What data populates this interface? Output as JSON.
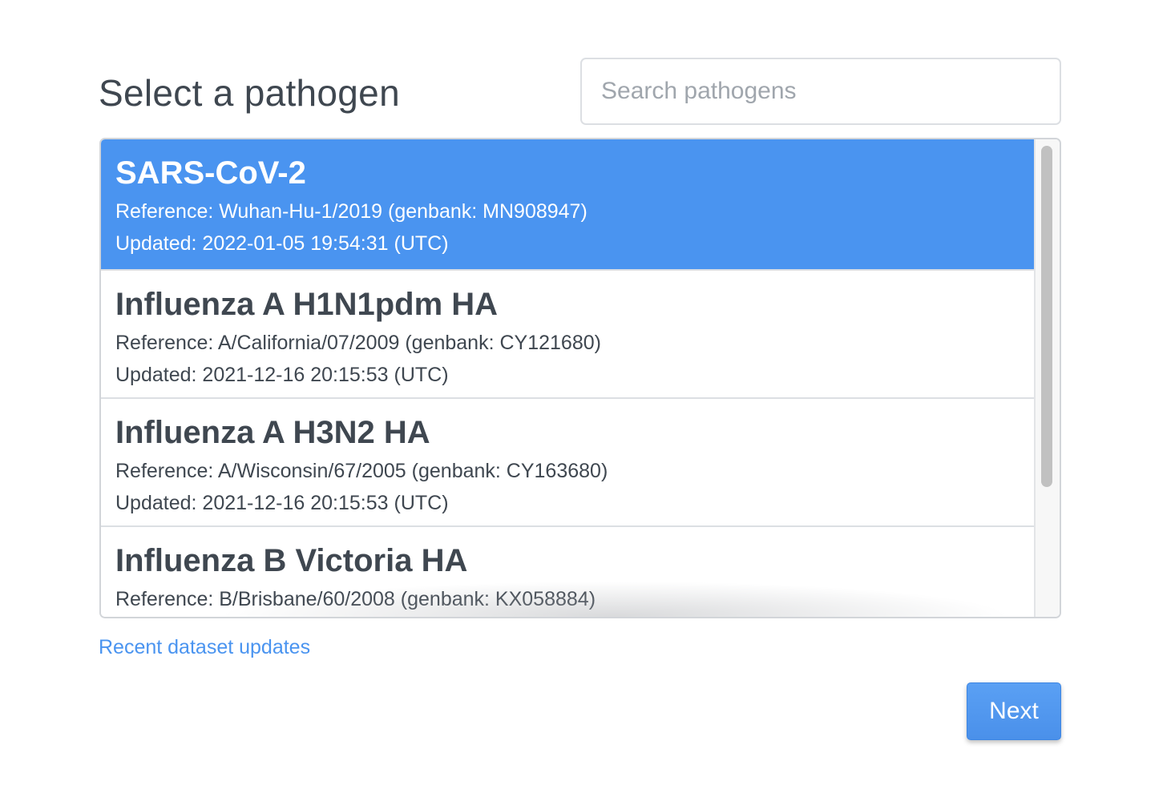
{
  "header": {
    "title": "Select a pathogen"
  },
  "search": {
    "placeholder": "Search pathogens",
    "value": ""
  },
  "pathogens": [
    {
      "name": "SARS-CoV-2",
      "reference": "Reference: Wuhan-Hu-1/2019 (genbank: MN908947)",
      "updated": "Updated: 2022-01-05 19:54:31 (UTC)",
      "selected": true
    },
    {
      "name": "Influenza A H1N1pdm HA",
      "reference": "Reference: A/California/07/2009 (genbank: CY121680)",
      "updated": "Updated: 2021-12-16 20:15:53 (UTC)",
      "selected": false
    },
    {
      "name": "Influenza A H3N2 HA",
      "reference": "Reference: A/Wisconsin/67/2005 (genbank: CY163680)",
      "updated": "Updated: 2021-12-16 20:15:53 (UTC)",
      "selected": false
    },
    {
      "name": "Influenza B Victoria HA",
      "reference": "Reference: B/Brisbane/60/2008 (genbank: KX058884)",
      "updated": "",
      "selected": false
    }
  ],
  "footer": {
    "recent_link": "Recent dataset updates",
    "next_label": "Next"
  },
  "colors": {
    "accent": "#4a94f0",
    "text": "#3f4750",
    "placeholder": "#a0a6ad",
    "border": "#dcdfe3"
  }
}
